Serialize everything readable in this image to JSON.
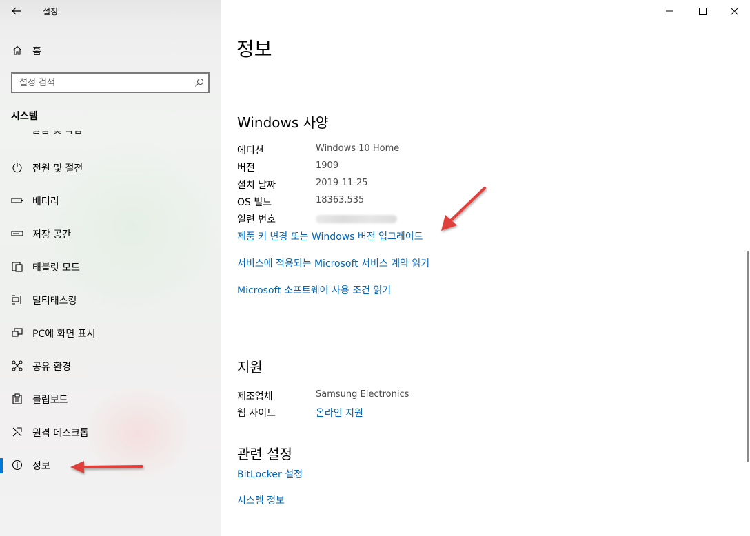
{
  "window": {
    "title": "설정",
    "controls": [
      "minimize",
      "maximize",
      "close"
    ]
  },
  "sidebar": {
    "home_label": "홈",
    "search": {
      "placeholder": "설정 검색",
      "value": ""
    },
    "section_title": "시스템",
    "partially_visible_item": "알림 및 작업",
    "items": [
      {
        "label": "전원 및 절전",
        "icon": "power-icon"
      },
      {
        "label": "배터리",
        "icon": "battery-icon"
      },
      {
        "label": "저장 공간",
        "icon": "storage-icon"
      },
      {
        "label": "태블릿 모드",
        "icon": "tablet-mode-icon"
      },
      {
        "label": "멀티태스킹",
        "icon": "multitasking-icon"
      },
      {
        "label": "PC에 화면 표시",
        "icon": "project-icon"
      },
      {
        "label": "공유 환경",
        "icon": "shared-experiences-icon"
      },
      {
        "label": "클립보드",
        "icon": "clipboard-icon"
      },
      {
        "label": "원격 데스크톱",
        "icon": "remote-desktop-icon"
      },
      {
        "label": "정보",
        "icon": "info-icon",
        "selected": true
      }
    ]
  },
  "main": {
    "page_title": "정보",
    "windows_spec": {
      "heading": "Windows 사양",
      "rows": [
        {
          "label": "에디션",
          "value": "Windows 10 Home"
        },
        {
          "label": "버전",
          "value": "1909"
        },
        {
          "label": "설치 날짜",
          "value": "2019-11-25"
        },
        {
          "label": "OS 빌드",
          "value": "18363.535"
        },
        {
          "label": "일련 번호",
          "value": ""
        }
      ],
      "links": [
        "제품 키 변경 또는 Windows 버전 업그레이드",
        "서비스에 적용되는 Microsoft 서비스 계약 읽기",
        "Microsoft 소프트웨어 사용 조건 읽기"
      ]
    },
    "support": {
      "heading": "지원",
      "manufacturer_label": "제조업체",
      "manufacturer_value": "Samsung Electronics",
      "website_label": "웹 사이트",
      "website_value": "온라인 지원"
    },
    "related": {
      "heading": "관련 설정",
      "links": [
        "BitLocker 설정",
        "시스템 정보"
      ]
    }
  },
  "colors": {
    "accent": "#0067b8",
    "selection_bar": "#0078d7",
    "annotation_arrow": "#e0403a"
  }
}
